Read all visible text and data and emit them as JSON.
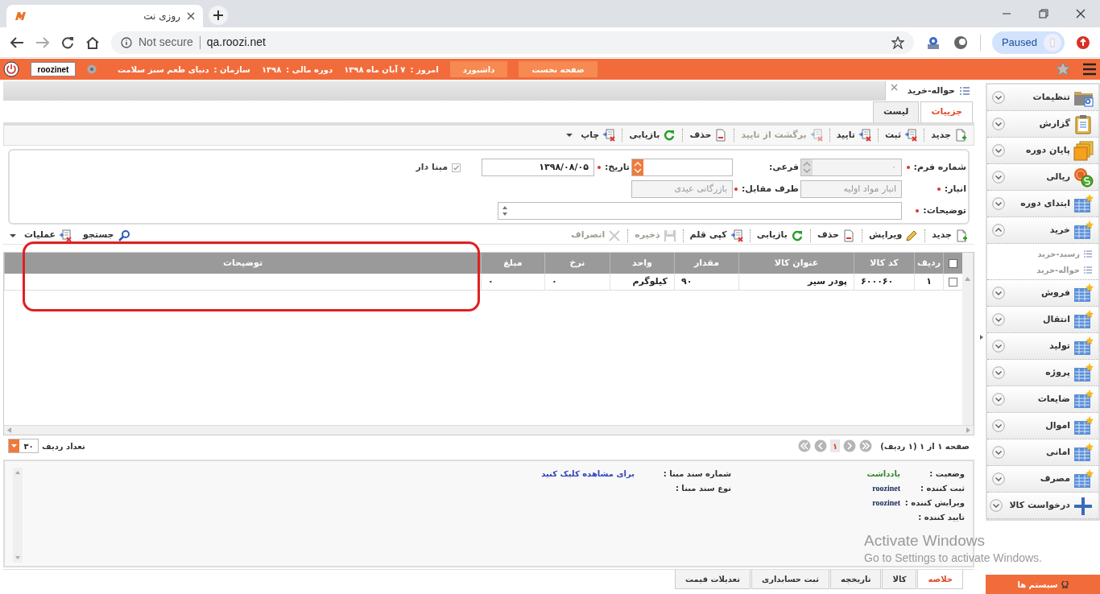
{
  "browser": {
    "tab_title": "روزی نت",
    "security_label": "Not secure",
    "url": "qa.roozi.net",
    "profile_status": "Paused"
  },
  "header": {
    "buttons": [
      "صفحه نخست",
      "داشبورد"
    ],
    "info": [
      {
        "label": "امروز :",
        "value": "۷ آبان ماه ۱۳۹۸"
      },
      {
        "label": "دوره مالی :",
        "value": "۱۳۹۸"
      },
      {
        "label": "سازمان :",
        "value": "دنیای طعم سبز سلامت"
      }
    ],
    "user": "roozinet"
  },
  "document_tab": {
    "title": "حواله-خرید"
  },
  "subtabs": [
    {
      "label": "جزییات",
      "selected": true
    },
    {
      "label": "لیست",
      "selected": false
    }
  ],
  "toolbar": [
    {
      "label": "جدید",
      "kind": "new",
      "disabled": false,
      "dropdown": false
    },
    {
      "label": "ثبت",
      "kind": "form",
      "disabled": false,
      "dropdown": false
    },
    {
      "label": "تایید",
      "kind": "form",
      "disabled": false,
      "dropdown": false
    },
    {
      "label": "برگشت از تایید",
      "kind": "form",
      "disabled": true,
      "dropdown": false
    },
    {
      "label": "حذف",
      "kind": "delete",
      "disabled": false,
      "dropdown": false
    },
    {
      "label": "بازیابی",
      "kind": "refresh",
      "disabled": false,
      "dropdown": false
    },
    {
      "label": "چاپ",
      "kind": "form",
      "disabled": false,
      "dropdown": true
    }
  ],
  "form": {
    "rows": [
      [
        {
          "label": "شماره فرم:",
          "required": true,
          "kind": "spinner",
          "value": "۰",
          "disabled": true
        },
        {
          "label": "فرعی:",
          "required": false,
          "kind": "spinner",
          "disabled": false
        },
        {
          "label": "تاریخ:",
          "required": true,
          "kind": "text",
          "value": "۱۳۹۸/۰۸/۰۵",
          "disabled": false
        },
        {
          "label": "مبنا دار",
          "kind": "checkbox",
          "checked": true,
          "disabled": true
        }
      ],
      [
        {
          "label": "انبار:",
          "required": true,
          "kind": "text",
          "value": "انبار مواد اولیه",
          "disabled": true
        },
        {
          "label": "طرف مقابل:",
          "required": true,
          "kind": "text",
          "value": "بازرگانی عیدی",
          "disabled": true
        }
      ],
      [
        {
          "label": "توضیحات:",
          "required": true,
          "kind": "textarea"
        }
      ]
    ]
  },
  "grid_toolbar": {
    "actions": [
      {
        "label": "جدید",
        "kind": "new",
        "disabled": false,
        "dropdown": false
      },
      {
        "label": "ویرایش",
        "kind": "edit",
        "disabled": false,
        "dropdown": false
      },
      {
        "label": "حذف",
        "kind": "delete",
        "disabled": false,
        "dropdown": false
      },
      {
        "label": "بازیابی",
        "kind": "refresh",
        "disabled": false,
        "dropdown": false
      },
      {
        "label": "کپی قلم",
        "kind": "form",
        "disabled": false,
        "dropdown": false
      },
      {
        "label": "ذخیره",
        "kind": "save",
        "disabled": true,
        "dropdown": false
      },
      {
        "label": "انصراف",
        "kind": "cancel",
        "disabled": true,
        "dropdown": false
      }
    ],
    "side_actions": [
      {
        "label": "جستجو",
        "kind": "search",
        "disabled": false,
        "dropdown": false
      },
      {
        "label": "عملیات",
        "kind": "form",
        "disabled": false,
        "dropdown": true
      }
    ]
  },
  "grid": {
    "select_all_checked": false,
    "columns": [
      "ردیف",
      "کد کالا",
      "عنوان کالا",
      "مقدار",
      "واحد",
      "نرخ",
      "مبلغ",
      "توضیحات"
    ],
    "rows": [
      {
        "selected": false,
        "cells": [
          "۱",
          "۶۰۰۰۶۰",
          "پودر سیر",
          "۹۰",
          "کیلوگرم",
          "۰",
          "۰"
        ]
      }
    ]
  },
  "annotation": {
    "kind": "rectangle"
  },
  "pager": {
    "summary": "صفحه ۱ از ۱ (۱ ردیف)",
    "page": "۱",
    "rows_per_page_label": "تعداد ردیف",
    "rows_per_page": "۳۰"
  },
  "summary": {
    "fields": [
      {
        "label": "وضعیت :",
        "value": "یادداشت",
        "kind": "status"
      },
      {
        "label": "ثبت کننده :",
        "value": "roozinet",
        "kind": "user"
      },
      {
        "label": "ویرایش کننده :",
        "value": "roozinet",
        "kind": "user"
      },
      {
        "label": "تایید کننده :"
      }
    ],
    "reference_fields": [
      "شماره سند مبنا :",
      "نوع سند مبنا :"
    ],
    "link": "برای مشاهده کلیک کنید"
  },
  "bottom_tabs": [
    {
      "label": "خلاصه",
      "selected": true
    },
    {
      "label": "کالا",
      "selected": false
    },
    {
      "label": "تاریخچه",
      "selected": false
    },
    {
      "label": "ثبت حسابداری",
      "selected": false
    },
    {
      "label": "تعدیلات قیمت",
      "selected": false
    }
  ],
  "sidebar": {
    "items": [
      {
        "label": "تنظیمات",
        "kind": "folder",
        "expanded": false
      },
      {
        "label": "گزارش",
        "kind": "clipboard",
        "expanded": false
      },
      {
        "label": "پایان دوره",
        "kind": "boxes",
        "expanded": false
      },
      {
        "label": "ریالی",
        "kind": "coins",
        "expanded": false
      },
      {
        "label": "ابتدای دوره",
        "kind": "table",
        "expanded": false
      },
      {
        "label": "خرید",
        "kind": "table",
        "expanded": true,
        "children": [
          {
            "label": "رسید-خرید"
          },
          {
            "label": "حواله-خرید"
          }
        ]
      },
      {
        "label": "فروش",
        "kind": "table",
        "expanded": false
      },
      {
        "label": "انتقال",
        "kind": "table",
        "expanded": false
      },
      {
        "label": "تولید",
        "kind": "table",
        "expanded": false
      },
      {
        "label": "پروژه",
        "kind": "table",
        "expanded": false
      },
      {
        "label": "ضایعات",
        "kind": "table",
        "expanded": false
      },
      {
        "label": "اموال",
        "kind": "table",
        "expanded": false
      },
      {
        "label": "امانی",
        "kind": "table",
        "expanded": false
      },
      {
        "label": "مصرف",
        "kind": "table",
        "expanded": false
      },
      {
        "label": "درخواست کالا",
        "kind": "plus",
        "expanded": false
      }
    ],
    "footer_button": "سیستم ها"
  },
  "os_notice": {
    "title": "Activate Windows",
    "subtitle": "Go to Settings to activate Windows."
  }
}
